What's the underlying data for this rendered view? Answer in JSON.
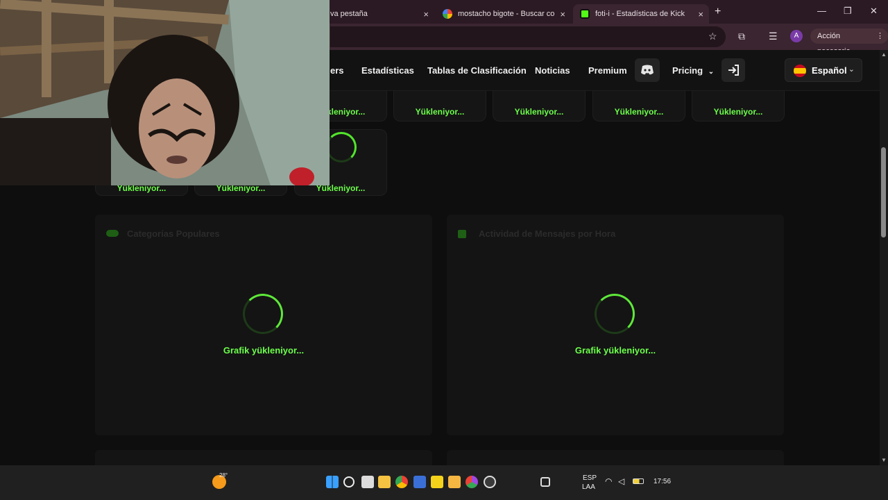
{
  "browser": {
    "tabs": [
      {
        "label": "va pestaña",
        "close": "×"
      },
      {
        "label": "mostacho bigote - Buscar con G",
        "close": "×"
      },
      {
        "label": "foti-i - Estadísticas de Kick",
        "close": "×"
      }
    ],
    "new_tab": "+",
    "needs_action": "Acción necesaria",
    "avatar_letter": "A",
    "window_controls": {
      "minimize": "—",
      "restore": "❐",
      "close": "✕"
    }
  },
  "nav": {
    "items": [
      "ers",
      "Estadísticas",
      "Tablas de Clasificación",
      "Noticias",
      "Premium"
    ],
    "pricing": "Pricing",
    "language": "Español"
  },
  "cards": {
    "loading_label": "Yükleniyor...",
    "row1_count": 5,
    "row2_count": 3
  },
  "panels": [
    {
      "title": "Categorías Populares",
      "loading": "Grafik yükleniyor..."
    },
    {
      "title": "Actividad de Mensajes por Hora",
      "loading": "Grafik yükleniyor..."
    }
  ],
  "taskbar": {
    "weather_temp": "28°",
    "lang_top": "ESP",
    "lang_bottom": "LAA",
    "time": "17:56"
  },
  "colors": {
    "accent_green": "#6cff4a",
    "tab_bar": "#2b1a23",
    "page_bg": "#0e0e0e"
  }
}
